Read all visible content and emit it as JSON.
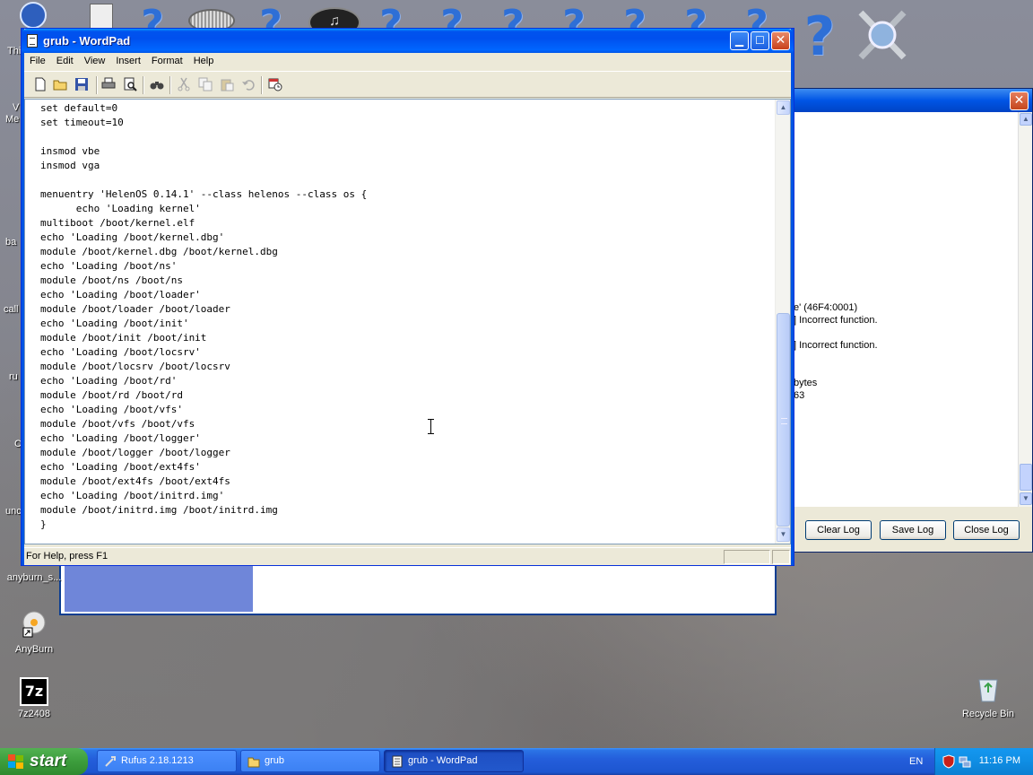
{
  "wordpad": {
    "title": "grub - WordPad",
    "menu": [
      "File",
      "Edit",
      "View",
      "Insert",
      "Format",
      "Help"
    ],
    "status": "For Help, press F1",
    "content_lines": [
      "set default=0",
      "set timeout=10",
      "",
      "insmod vbe",
      "insmod vga",
      "",
      "menuentry 'HelenOS 0.14.1' --class helenos --class os {",
      "      echo 'Loading kernel'",
      "multiboot /boot/kernel.elf",
      "echo 'Loading /boot/kernel.dbg'",
      "module /boot/kernel.dbg /boot/kernel.dbg",
      "echo 'Loading /boot/ns'",
      "module /boot/ns /boot/ns",
      "echo 'Loading /boot/loader'",
      "module /boot/loader /boot/loader",
      "echo 'Loading /boot/init'",
      "module /boot/init /boot/init",
      "echo 'Loading /boot/locsrv'",
      "module /boot/locsrv /boot/locsrv",
      "echo 'Loading /boot/rd'",
      "module /boot/rd /boot/rd",
      "echo 'Loading /boot/vfs'",
      "module /boot/vfs /boot/vfs",
      "echo 'Loading /boot/logger'",
      "module /boot/logger /boot/logger",
      "echo 'Loading /boot/ext4fs'",
      "module /boot/ext4fs /boot/ext4fs",
      "echo 'Loading /boot/initrd.img'",
      "module /boot/initrd.img /boot/initrd.img",
      "}"
    ]
  },
  "rufus_log": {
    "lines": [
      "e' (46F4:0001)",
      "] Incorrect function.",
      "] Incorrect function.",
      "bytes",
      "63"
    ],
    "buttons": {
      "clear": "Clear Log",
      "save": "Save Log",
      "close": "Close Log"
    }
  },
  "desktop": {
    "icons": [
      {
        "label": "anyburn_s..."
      },
      {
        "label": "AnyBurn"
      },
      {
        "label": "7z2408"
      },
      {
        "label": "Recycle Bin"
      }
    ],
    "left_fragments": [
      "Thi",
      "V",
      "Me",
      "ba",
      "call",
      "ru",
      "C",
      "unc"
    ]
  },
  "taskbar": {
    "start_label": "start",
    "tasks": [
      {
        "label": "Rufus 2.18.1213"
      },
      {
        "label": "grub"
      },
      {
        "label": "grub - WordPad"
      }
    ],
    "lang": "EN",
    "clock": "11:16 PM"
  },
  "colors": {
    "title_blue": "#0055e5",
    "taskbar_blue": "#245edb",
    "start_green": "#3c9d3c",
    "tray_blue": "#0f8ee4"
  }
}
